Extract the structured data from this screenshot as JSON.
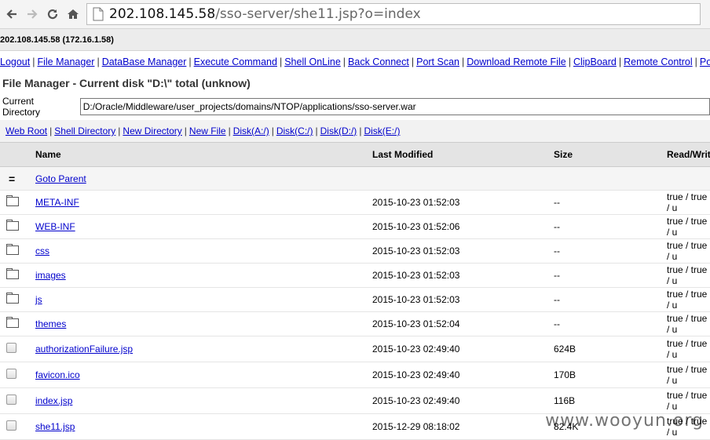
{
  "browser": {
    "url_host": "202.108.145.58",
    "url_path": "/sso-server/she11.jsp?o=index"
  },
  "host_info": "202.108.145.58 (172.16.1.58)",
  "menu": [
    "Logout",
    "File Manager",
    "DataBase Manager",
    "Execute Command",
    "Shell OnLine",
    "Back Connect",
    "Port Scan",
    "Download Remote File",
    "ClipBoard",
    "Remote Control",
    "Port Map"
  ],
  "file_manager": {
    "title": "File Manager - Current disk \"D:\\\" total (unknow)",
    "current_dir_label": "Current Directory",
    "current_dir_value": "D:/Oracle/Middleware/user_projects/domains/NTOP/applications/sso-server.war",
    "links": [
      "Web Root",
      "Shell Directory",
      "New Directory",
      "New File",
      "Disk(A:/)",
      "Disk(C:/)",
      "Disk(D:/)",
      "Disk(E:/)"
    ],
    "columns": [
      "Name",
      "Last Modified",
      "Size",
      "Read/Write"
    ],
    "parent_label": "Goto Parent",
    "rows": [
      {
        "type": "dir",
        "name": "META-INF",
        "modified": "2015-10-23 01:52:03",
        "size": "--",
        "rw": "true / true / u"
      },
      {
        "type": "dir",
        "name": "WEB-INF",
        "modified": "2015-10-23 01:52:06",
        "size": "--",
        "rw": "true / true / u"
      },
      {
        "type": "dir",
        "name": "css",
        "modified": "2015-10-23 01:52:03",
        "size": "--",
        "rw": "true / true / u"
      },
      {
        "type": "dir",
        "name": "images",
        "modified": "2015-10-23 01:52:03",
        "size": "--",
        "rw": "true / true / u"
      },
      {
        "type": "dir",
        "name": "js",
        "modified": "2015-10-23 01:52:03",
        "size": "--",
        "rw": "true / true / u"
      },
      {
        "type": "dir",
        "name": "themes",
        "modified": "2015-10-23 01:52:04",
        "size": "--",
        "rw": "true / true / u"
      },
      {
        "type": "file",
        "name": "authorizationFailure.jsp",
        "modified": "2015-10-23 02:49:40",
        "size": "624B",
        "rw": "true / true / u"
      },
      {
        "type": "file",
        "name": "favicon.ico",
        "modified": "2015-10-23 02:49:40",
        "size": "170B",
        "rw": "true / true / u"
      },
      {
        "type": "file",
        "name": "index.jsp",
        "modified": "2015-10-23 02:49:40",
        "size": "116B",
        "rw": "true / true / u"
      },
      {
        "type": "file",
        "name": "she11.jsp",
        "modified": "2015-12-29 08:18:02",
        "size": "82.4K",
        "rw": "true / true / u"
      }
    ]
  },
  "watermark": "www.wooyun.org"
}
